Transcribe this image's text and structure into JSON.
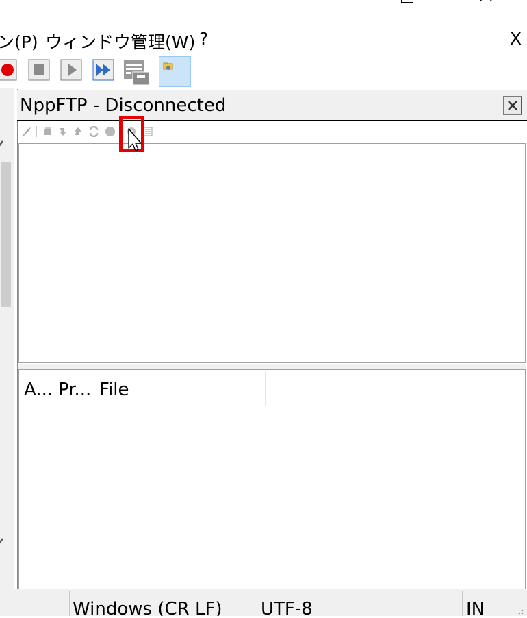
{
  "window": {
    "maximize_icon": "maximize-icon",
    "close_icon": "close-icon"
  },
  "menu": {
    "items": [
      {
        "label": "ン(P)"
      },
      {
        "label": "ウィンドウ管理(W)"
      },
      {
        "label": "?"
      }
    ],
    "close_label": "X"
  },
  "toolbar": {
    "buttons": [
      {
        "icon": "record-macro-icon"
      },
      {
        "icon": "stop-recording-icon"
      },
      {
        "icon": "playback-icon"
      },
      {
        "icon": "run-multiple-icon"
      },
      {
        "icon": "save-macro-icon"
      },
      {
        "icon": "nppftp-folder-icon"
      }
    ]
  },
  "panel": {
    "title": "NppFTP - Disconnected",
    "close_label": "x",
    "toolbar_icons": [
      "connect-icon",
      "refresh-icon",
      "download-icon",
      "upload-icon",
      "sync-icon",
      "abort-icon",
      "settings-icon",
      "messages-icon"
    ],
    "columns": [
      {
        "label": "A..."
      },
      {
        "label": "Pr..."
      },
      {
        "label": "File"
      }
    ]
  },
  "statusbar": {
    "eol": "Windows (CR LF)",
    "encoding": "UTF-8",
    "mode": "IN"
  },
  "colors": {
    "highlight": "#e60000",
    "active_button": "#cce4f7",
    "record_red": "#e00000",
    "toolbar_blue": "#2c6bc8"
  }
}
